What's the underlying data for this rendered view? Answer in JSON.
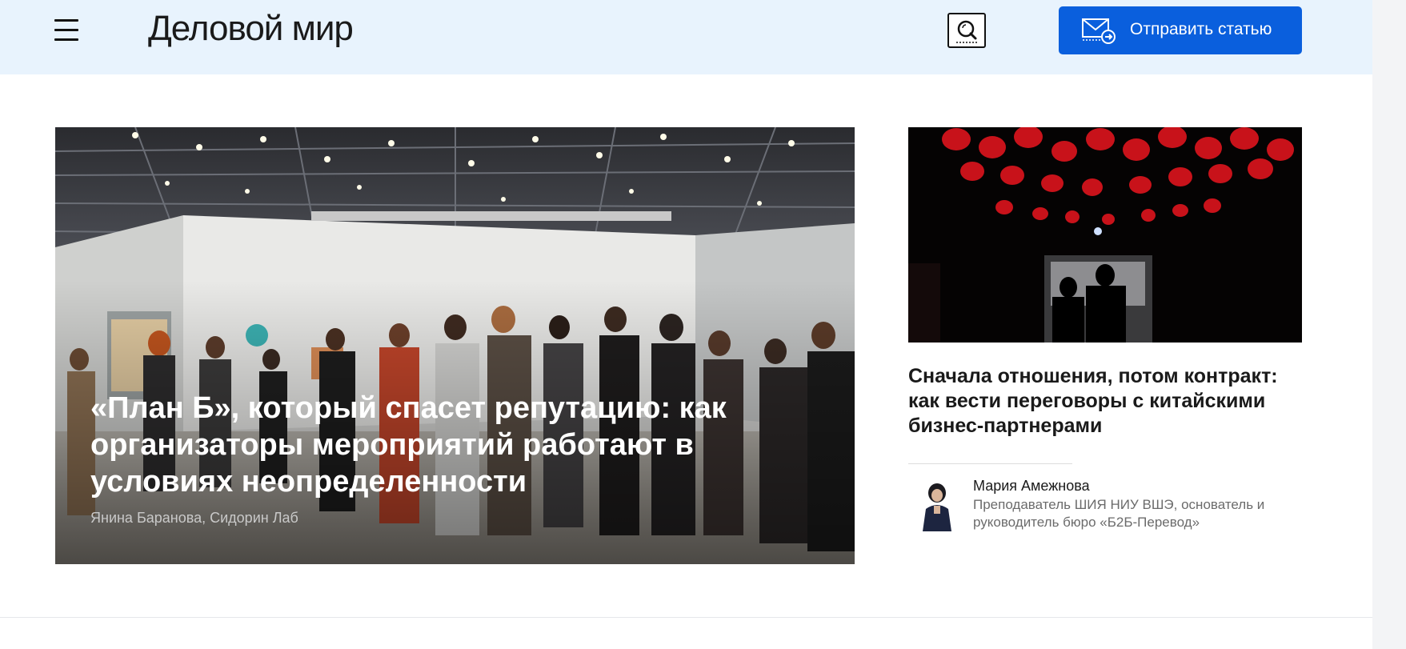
{
  "header": {
    "logo_text": "Деловой мир",
    "send_button_label": "Отправить статью",
    "menu_icon": "hamburger-menu-icon",
    "search_icon": "search-icon",
    "send_icon": "envelope-arrow-icon",
    "accent_color": "#0a5fdd",
    "header_bg": "#e8f3fd"
  },
  "hero": {
    "title": "«План Б», который спасет репутацию: как организаторы мероприятий работают в условиях неопределенности",
    "author": "Янина Баранова, Сидорин Лаб"
  },
  "side_article": {
    "title": "Сначала отношения, потом контракт: как вести переговоры с китайскими бизнес-партнерами",
    "author_name": "Мария Амежнова",
    "author_role": "Преподаватель ШИЯ НИУ ВШЭ, основатель и руководитель бюро «Б2Б-Перевод»"
  }
}
